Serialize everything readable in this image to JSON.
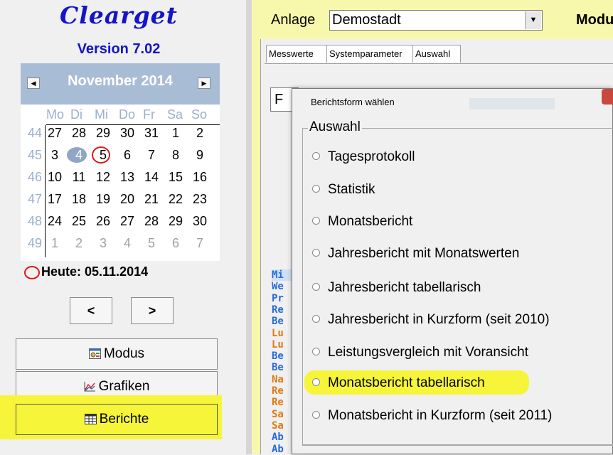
{
  "app": {
    "brand": "Clearget",
    "version": "Version 7.02"
  },
  "colors": {
    "brand_blue": "#1414c8",
    "calendar_header": "#a9bcd6",
    "highlight_yellow": "#f6f53a",
    "right_panel_yellow": "#f8f8ad",
    "annotation_red": "#e01818"
  },
  "calendar": {
    "month_label": "November 2014",
    "prev_icon": "triangle-left-icon",
    "next_icon": "triangle-right-icon",
    "weekdays": [
      "Mo",
      "Di",
      "Mi",
      "Do",
      "Fr",
      "Sa",
      "So"
    ],
    "weeks": [
      {
        "nr": "44",
        "days": [
          "27",
          "28",
          "29",
          "30",
          "31",
          "1",
          "2"
        ]
      },
      {
        "nr": "45",
        "days": [
          "3",
          "4",
          "5",
          "6",
          "7",
          "8",
          "9"
        ]
      },
      {
        "nr": "46",
        "days": [
          "10",
          "11",
          "12",
          "13",
          "14",
          "15",
          "16"
        ]
      },
      {
        "nr": "47",
        "days": [
          "17",
          "18",
          "19",
          "20",
          "21",
          "22",
          "23"
        ]
      },
      {
        "nr": "48",
        "days": [
          "24",
          "25",
          "26",
          "27",
          "28",
          "29",
          "30"
        ]
      },
      {
        "nr": "49",
        "days": [
          "1",
          "2",
          "3",
          "4",
          "5",
          "6",
          "7"
        ]
      }
    ],
    "selected_day": "4",
    "today_day": "5",
    "today_label": "Heute: 05.11.2014"
  },
  "nav": {
    "prev_label": "<",
    "next_label": ">"
  },
  "buttons": {
    "modus": "Modus",
    "grafiken": "Grafiken",
    "berichte": "Berichte"
  },
  "header": {
    "anlage_label": "Anlage",
    "anlage_value": "Demostadt",
    "mode_label": "Modu"
  },
  "tabs": [
    "Messwerte",
    "Systemparameter",
    "Auswahl"
  ],
  "background_list": {
    "combo_value": "F",
    "rows": [
      {
        "text": "Mi",
        "color": "#2a6ad8"
      },
      {
        "text": "We",
        "color": "#2a6ad8"
      },
      {
        "text": "Pr",
        "color": "#2a6ad8"
      },
      {
        "text": "Re",
        "color": "#2a6ad8"
      },
      {
        "text": "Be",
        "color": "#2a6ad8"
      },
      {
        "text": "Lu",
        "color": "#e07a10"
      },
      {
        "text": "Lu",
        "color": "#e07a10"
      },
      {
        "text": "Be",
        "color": "#2a6ad8"
      },
      {
        "text": "Be",
        "color": "#2a6ad8"
      },
      {
        "text": "Na",
        "color": "#e07a10"
      },
      {
        "text": "Re",
        "color": "#e07a10"
      },
      {
        "text": "Re",
        "color": "#e07a10"
      },
      {
        "text": "Sa",
        "color": "#e07a10"
      },
      {
        "text": "Sa",
        "color": "#e07a10"
      },
      {
        "text": "Ab",
        "color": "#2a6ad8"
      },
      {
        "text": "Ab",
        "color": "#2a6ad8"
      }
    ]
  },
  "dialog": {
    "title": "Berichtsform wählen",
    "group_label": "Auswahl",
    "options": [
      "Tagesprotokoll",
      "Statistik",
      "Monatsbericht",
      "Jahresbericht mit Monatswerten",
      "Jahresbericht tabellarisch",
      "Jahresbericht in Kurzform (seit 2010)",
      "Leistungsvergleich mit Voransicht",
      "Monatsbericht tabellarisch",
      "Monatsbericht in Kurzform (seit 2011)"
    ],
    "highlighted_option": "Monatsbericht tabellarisch"
  }
}
